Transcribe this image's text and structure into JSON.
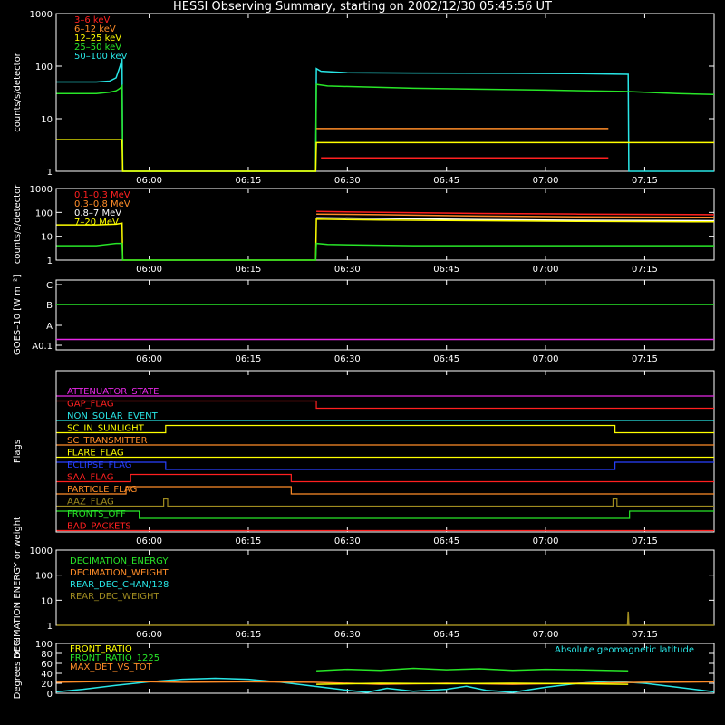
{
  "title": "HESSI Observing Summary, starting on 2002/12/30 05:45:56 UT",
  "time_axis": {
    "ticks": [
      "06:00",
      "06:15",
      "06:30",
      "06:45",
      "07:00",
      "07:15"
    ],
    "tick_minutes": [
      360,
      375,
      390,
      405,
      420,
      435
    ],
    "range_minutes": [
      345.93,
      445.5
    ]
  },
  "colors": {
    "red": "#ff2020",
    "orange": "#ff8c28",
    "yellow": "#ffff00",
    "green": "#28e628",
    "cyan": "#28e6e6",
    "magenta": "#e628e6",
    "blue": "#2840ff",
    "olive": "#a08c20",
    "white": "#ffffff"
  },
  "chart_data": [
    {
      "id": "rates",
      "type": "line",
      "ylabel": "counts/s/detector",
      "yscale": "log",
      "ylim": [
        1,
        1000
      ],
      "yticks": [
        "1",
        "10",
        "100",
        "1000"
      ],
      "ytick_values": [
        1,
        10,
        100,
        1000
      ],
      "legend": [
        {
          "name": "3–6 keV",
          "color": "#ff2020"
        },
        {
          "name": "6–12 keV",
          "color": "#ff8c28"
        },
        {
          "name": "12–25 keV",
          "color": "#ffff00"
        },
        {
          "name": "25–50 keV",
          "color": "#28e628"
        },
        {
          "name": "50–100 keV",
          "color": "#28e6e6"
        }
      ],
      "series": [
        {
          "name": "50–100 keV",
          "color": "#28e6e6",
          "x": [
            346,
            352,
            354,
            355,
            355.6,
            355.9,
            356.0,
            385.2,
            385.3,
            386,
            390,
            400,
            415,
            425,
            432.5,
            432.6,
            445.5
          ],
          "y": [
            50,
            50,
            52,
            60,
            100,
            140,
            1,
            1,
            90,
            80,
            75,
            74,
            73,
            72,
            70,
            1,
            1
          ]
        },
        {
          "name": "25–50 keV",
          "color": "#28e628",
          "x": [
            346,
            352,
            354,
            355,
            355.6,
            355.9,
            356.0,
            385.2,
            385.3,
            387,
            400,
            420,
            432,
            440,
            445.5
          ],
          "y": [
            30,
            30,
            32,
            34,
            38,
            42,
            1,
            1,
            45,
            42,
            38,
            35,
            33,
            30,
            29
          ]
        },
        {
          "name": "12–25 keV",
          "color": "#ffff00",
          "x": [
            346,
            355.9,
            356.0,
            385.2,
            385.3,
            420,
            429.5,
            429.6,
            432.8,
            432.9,
            445.5
          ],
          "y": [
            4,
            4,
            1,
            1,
            3.5,
            3.5,
            3.5,
            3.5,
            3.5,
            3.5,
            3.5
          ]
        },
        {
          "name": "6–12 keV",
          "color": "#ff8c28",
          "x": [
            385.3,
            400,
            420,
            429.5
          ],
          "y": [
            6.5,
            6.5,
            6.5,
            6.5
          ]
        },
        {
          "name": "3–6 keV",
          "color": "#ff2020",
          "x": [
            386,
            395,
            405,
            415,
            425,
            429.5
          ],
          "y": [
            1.8,
            1.8,
            1.8,
            1.8,
            1.8,
            1.8
          ]
        }
      ]
    },
    {
      "id": "high_energy",
      "type": "line",
      "ylabel": "counts/s/detector",
      "yscale": "log",
      "ylim": [
        1,
        1000
      ],
      "yticks": [
        "1",
        "10",
        "100",
        "1000"
      ],
      "ytick_values": [
        1,
        10,
        100,
        1000
      ],
      "legend": [
        {
          "name": "0.1–0.3 MeV",
          "color": "#ff2020"
        },
        {
          "name": "0.3–0.8 MeV",
          "color": "#ff8c28"
        },
        {
          "name": "0.8–7 MeV",
          "color": "#ffffff"
        },
        {
          "name": "7–20 MeV",
          "color": "#ffff00"
        }
      ],
      "series": [
        {
          "name": "0.1–0.3 MeV",
          "color": "#ff2020",
          "x": [
            385.3,
            395,
            410,
            425,
            445.5
          ],
          "y": [
            110,
            100,
            90,
            85,
            80
          ]
        },
        {
          "name": "0.3–0.8 MeV",
          "color": "#ff8c28",
          "x": [
            385.3,
            395,
            410,
            425,
            445.5
          ],
          "y": [
            85,
            80,
            70,
            65,
            62
          ]
        },
        {
          "name": "0.8–7 MeV",
          "color": "#ffffff",
          "x": [
            385.3,
            395,
            410,
            425,
            445.5
          ],
          "y": [
            60,
            56,
            50,
            47,
            45
          ]
        },
        {
          "name": "7–20 MeV",
          "color": "#ffff00",
          "x": [
            346,
            352,
            355,
            355.9,
            356.0,
            385.2,
            385.3,
            395,
            410,
            425,
            445.5
          ],
          "y": [
            30,
            30,
            32,
            35,
            1,
            1,
            52,
            48,
            45,
            42,
            40
          ]
        },
        {
          "name": "green",
          "color": "#28e628",
          "x": [
            346,
            352,
            355,
            355.9,
            356.0,
            385.2,
            385.3,
            387,
            400,
            420,
            445.5
          ],
          "y": [
            4,
            4,
            5,
            5,
            1,
            1,
            5,
            4.5,
            4,
            4,
            4
          ]
        }
      ]
    },
    {
      "id": "goes",
      "type": "line",
      "ylabel": "GOES–10 [W m⁻²]",
      "yticks": [
        "C",
        "B",
        "A",
        "A0.1"
      ],
      "series": [
        {
          "name": "green",
          "color": "#28e628",
          "level": 0.65
        },
        {
          "name": "magenta",
          "color": "#e628e6",
          "level": 0.15
        }
      ]
    },
    {
      "id": "flags",
      "type": "line",
      "ylabel": "Flags",
      "flags": [
        {
          "name": "ATTENUATOR_STATE",
          "color": "#e628e6",
          "steps": [
            [
              346,
              0
            ],
            [
              445.5,
              0
            ]
          ]
        },
        {
          "name": "GAP_FLAG",
          "color": "#ff2020",
          "steps": [
            [
              346,
              1
            ],
            [
              385.3,
              0
            ],
            [
              445.5,
              0
            ]
          ]
        },
        {
          "name": "NON_SOLAR_EVENT",
          "color": "#28e6e6",
          "steps": [
            [
              346,
              0
            ],
            [
              445.5,
              0
            ]
          ]
        },
        {
          "name": "SC_IN_SUNLIGHT",
          "color": "#ffff00",
          "steps": [
            [
              346,
              0
            ],
            [
              362.5,
              1
            ],
            [
              430.5,
              0
            ],
            [
              445.5,
              0
            ]
          ]
        },
        {
          "name": "SC_TRANSMITTER",
          "color": "#ff8c28",
          "steps": [
            [
              346,
              0
            ],
            [
              445.5,
              0
            ]
          ]
        },
        {
          "name": "FLARE_FLAG",
          "color": "#ffff00",
          "steps": [
            [
              346,
              0
            ],
            [
              445.5,
              0
            ]
          ]
        },
        {
          "name": "ECLIPSE_FLAG",
          "color": "#2840ff",
          "steps": [
            [
              346,
              1
            ],
            [
              362.5,
              0
            ],
            [
              430.5,
              1
            ],
            [
              445.5,
              1
            ]
          ]
        },
        {
          "name": "SAA_FLAG",
          "color": "#ff2020",
          "steps": [
            [
              346,
              0
            ],
            [
              357.2,
              1
            ],
            [
              381.5,
              0
            ],
            [
              445.5,
              0
            ]
          ]
        },
        {
          "name": "PARTICLE_FLAG",
          "color": "#ff8c28",
          "steps": [
            [
              346,
              0
            ],
            [
              356.5,
              1
            ],
            [
              381.5,
              0
            ],
            [
              445.5,
              0
            ]
          ]
        },
        {
          "name": "AAZ_FLAG",
          "color": "#a08c20",
          "steps": [
            [
              346,
              0
            ],
            [
              362.2,
              1
            ],
            [
              362.8,
              0
            ],
            [
              430.2,
              1
            ],
            [
              430.8,
              0
            ],
            [
              445.5,
              0
            ]
          ]
        },
        {
          "name": "FRONTS_OFF",
          "color": "#28e628",
          "steps": [
            [
              346,
              1
            ],
            [
              358.5,
              0
            ],
            [
              432.7,
              1
            ],
            [
              445.5,
              1
            ]
          ]
        },
        {
          "name": "BAD_PACKETS",
          "color": "#ff2020",
          "steps": [
            [
              346,
              0
            ],
            [
              445.5,
              0
            ]
          ]
        }
      ]
    },
    {
      "id": "decimation",
      "type": "line",
      "ylabel": "DECIMATION ENERGY or weight",
      "yscale": "log",
      "ylim": [
        1,
        1000
      ],
      "yticks": [
        "1",
        "10",
        "100",
        "1000"
      ],
      "ytick_values": [
        1,
        10,
        100,
        1000
      ],
      "legend": [
        {
          "name": "DECIMATION_ENERGY",
          "color": "#28e628"
        },
        {
          "name": "DECIMATION_WEIGHT",
          "color": "#ff8c28"
        },
        {
          "name": "REAR_DEC_CHAN/128",
          "color": "#28e6e6"
        },
        {
          "name": "REAR_DEC_WEIGHT",
          "color": "#a08c20"
        }
      ],
      "series": [
        {
          "name": "REAR_DEC_WEIGHT",
          "color": "#a08c20",
          "x": [
            346,
            432.4,
            432.5,
            432.6,
            445.5
          ],
          "y": [
            1,
            1,
            3.5,
            1,
            1
          ]
        }
      ]
    },
    {
      "id": "ratios",
      "type": "line",
      "ylabel": "Degrees or %",
      "ylim": [
        0,
        100
      ],
      "yticks": [
        "0",
        "20",
        "40",
        "60",
        "80",
        "100"
      ],
      "ytick_values": [
        0,
        20,
        40,
        60,
        80,
        100
      ],
      "legend": [
        {
          "name": "FRONT_RATIO",
          "color": "#ffff00"
        },
        {
          "name": "FRONT_RATIO_1225",
          "color": "#28e628"
        },
        {
          "name": "MAX_DET_VS_TOT",
          "color": "#ff8c28"
        }
      ],
      "annotation": {
        "text": "Absolute geomagnetic latitude",
        "color": "#28e6e6"
      },
      "series": [
        {
          "name": "Absolute geomagnetic latitude",
          "color": "#28e6e6",
          "x": [
            346,
            350,
            355,
            360,
            365,
            370,
            375,
            380,
            385,
            390,
            393,
            396,
            400,
            405,
            408,
            411,
            415,
            420,
            425,
            430,
            435,
            440,
            445.5
          ],
          "y": [
            3,
            8,
            16,
            23,
            28,
            30,
            28,
            22,
            14,
            6,
            2,
            10,
            4,
            8,
            14,
            6,
            2,
            12,
            20,
            24,
            20,
            12,
            3
          ]
        },
        {
          "name": "MAX_DET_VS_TOT",
          "color": "#ff8c28",
          "x": [
            346,
            355,
            365,
            375,
            385,
            395,
            405,
            415,
            425,
            435,
            445.5
          ],
          "y": [
            22,
            24,
            22,
            23,
            22,
            18,
            20,
            18,
            20,
            22,
            23
          ]
        },
        {
          "name": "FRONT_RATIO_1225",
          "color": "#28e628",
          "x": [
            385.3,
            390,
            395,
            400,
            405,
            410,
            415,
            420,
            425,
            432.5
          ],
          "y": [
            45,
            48,
            46,
            50,
            47,
            49,
            46,
            48,
            47,
            45
          ]
        },
        {
          "name": "FRONT_RATIO",
          "color": "#ffff00",
          "x": [
            385.3,
            395,
            405,
            415,
            425,
            432.5
          ],
          "y": [
            18,
            20,
            19,
            20,
            19,
            18
          ]
        }
      ]
    }
  ]
}
